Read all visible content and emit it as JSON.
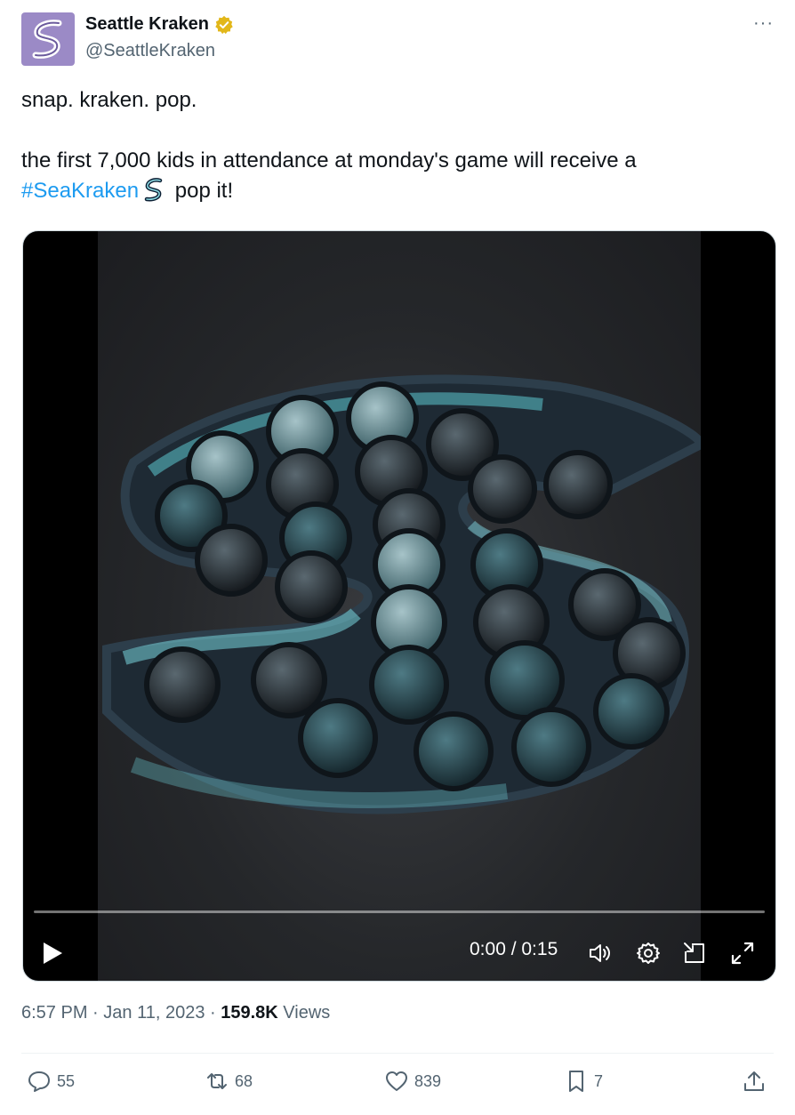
{
  "author": {
    "display_name": "Seattle Kraken",
    "handle": "@SeattleKraken",
    "verified": true
  },
  "menu": {
    "more_label": "···"
  },
  "tweet": {
    "line1": "snap. kraken. pop.",
    "line2": "the first 7,000 kids in attendance at monday's game will receive a",
    "hashtag": "#SeaKraken",
    "line3_tail": " pop it!"
  },
  "video": {
    "time_display": "0:00 / 0:15",
    "progress": 0,
    "controls": [
      "play-icon",
      "volume-icon",
      "settings-icon",
      "pip-icon",
      "fullscreen-icon"
    ]
  },
  "meta": {
    "time": "6:57 PM",
    "separator": " · ",
    "date": "Jan 11, 2023",
    "views_count": "159.8K",
    "views_label": " Views"
  },
  "actions": {
    "replies": "55",
    "retweets": "68",
    "likes": "839",
    "bookmarks": "7"
  },
  "colors": {
    "accent": "#1d9bf0",
    "secondary_text": "#536471",
    "avatar_bg": "#9b8ac6",
    "verified_gold": "#e2b719"
  }
}
